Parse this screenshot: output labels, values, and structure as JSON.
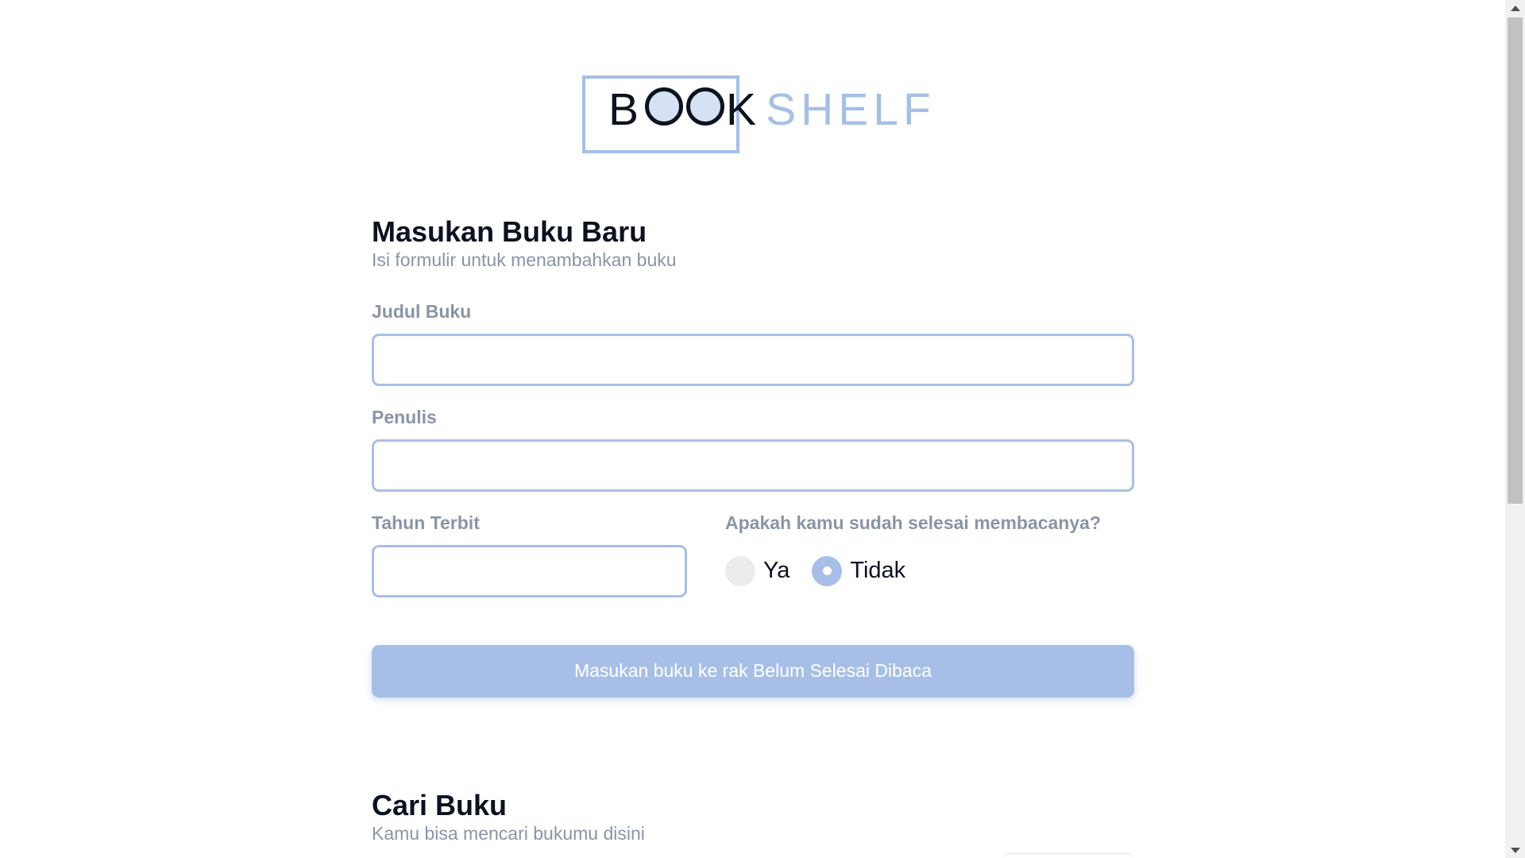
{
  "logo": {
    "part1_prefix": "B",
    "part1_suffix": "K",
    "part2": "SHELF",
    "alt": "BOOKSHELF"
  },
  "add_book": {
    "title": "Masukan Buku Baru",
    "subtitle": "Isi formulir untuk menambahkan buku",
    "title_field": {
      "label": "Judul Buku",
      "value": ""
    },
    "author_field": {
      "label": "Penulis",
      "value": ""
    },
    "year_field": {
      "label": "Tahun Terbit",
      "value": ""
    },
    "finished_question": {
      "label": "Apakah kamu sudah selesai membacanya?",
      "options": [
        {
          "label": "Ya",
          "checked": false
        },
        {
          "label": "Tidak",
          "checked": true
        }
      ]
    },
    "submit_label": "Masukan buku ke rak Belum Selesai Dibaca"
  },
  "search": {
    "title": "Cari Buku",
    "subtitle": "Kamu bisa mencari bukumu disini"
  },
  "colors": {
    "accent": "#a7bfe6",
    "text_dark": "#0b1220",
    "text_muted": "#8a94a6"
  }
}
